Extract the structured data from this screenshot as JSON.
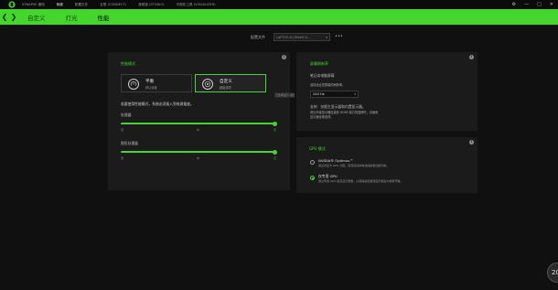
{
  "titlebar": {
    "nav": [
      "SYNAPSE 通知",
      "系统",
      "配置文件",
      "互联 (CONNECT)",
      "音频室 (STUDIO)",
      "可视化工具 (VISUALIZER)"
    ],
    "active_index": 1,
    "controls": [
      "⚙",
      "—",
      "□",
      "✕"
    ]
  },
  "subnav": {
    "back": "❮",
    "forward": "❯",
    "tabs": [
      "自定义",
      "灯光",
      "性能"
    ],
    "active_index": 2
  },
  "profile": {
    "label": "配置文件",
    "value": "LAPTOP-4Q7BAHE.0...",
    "more": "•••"
  },
  "performance": {
    "title": "性能模式",
    "info": "i",
    "modes": [
      {
        "name": "平衡",
        "sub": "默认设置",
        "icon": "balance-gauge-icon"
      },
      {
        "name": "自定义",
        "sub": "超级选项",
        "icon": "custom-gauge-icon"
      }
    ],
    "selected_mode": 1,
    "tooltip": "已选择自定义模式",
    "description": "若要使用性能模式，系统必须插入到电源插座。",
    "cpu": {
      "label": "处理器",
      "ticks": [
        "低",
        "中",
        "高"
      ],
      "value": 1.0
    },
    "gpu": {
      "label": "图形处理器",
      "ticks": [
        "低",
        "中",
        "高"
      ],
      "value": 1.0
    }
  },
  "refresh": {
    "title": "屏幕刷新率",
    "info": "i",
    "subtitle": "笔记本电脑屏幕",
    "hint": "选择适合您屏幕的刷新率。",
    "hz_value": "240 Hz",
    "caret": "▾",
    "note_line1": "支持：仅限主显示器和内置显示器。",
    "note_line2": "看比外接显示器连接到 HDMI 端口的插槽时，请使用",
    "note_line3": "显示器设置选项。"
  },
  "gpu_mode": {
    "title": "GPU 模式",
    "info": "i",
    "options": [
      {
        "name": "NVIDIA® Optimus™",
        "desc": "通过对显卡 GPU 分配，实现良好的电池续航和性能平衡。"
      },
      {
        "name": "仅专用 GPU",
        "desc": "通过专用 GPU 提高显示质量，以获得最佳游戏显示和最大帧率开销。"
      }
    ],
    "selected": 1
  },
  "badge": "20",
  "colors": {
    "accent": "#44d62c",
    "panel": "#1b1b1b",
    "background": "#101010"
  }
}
